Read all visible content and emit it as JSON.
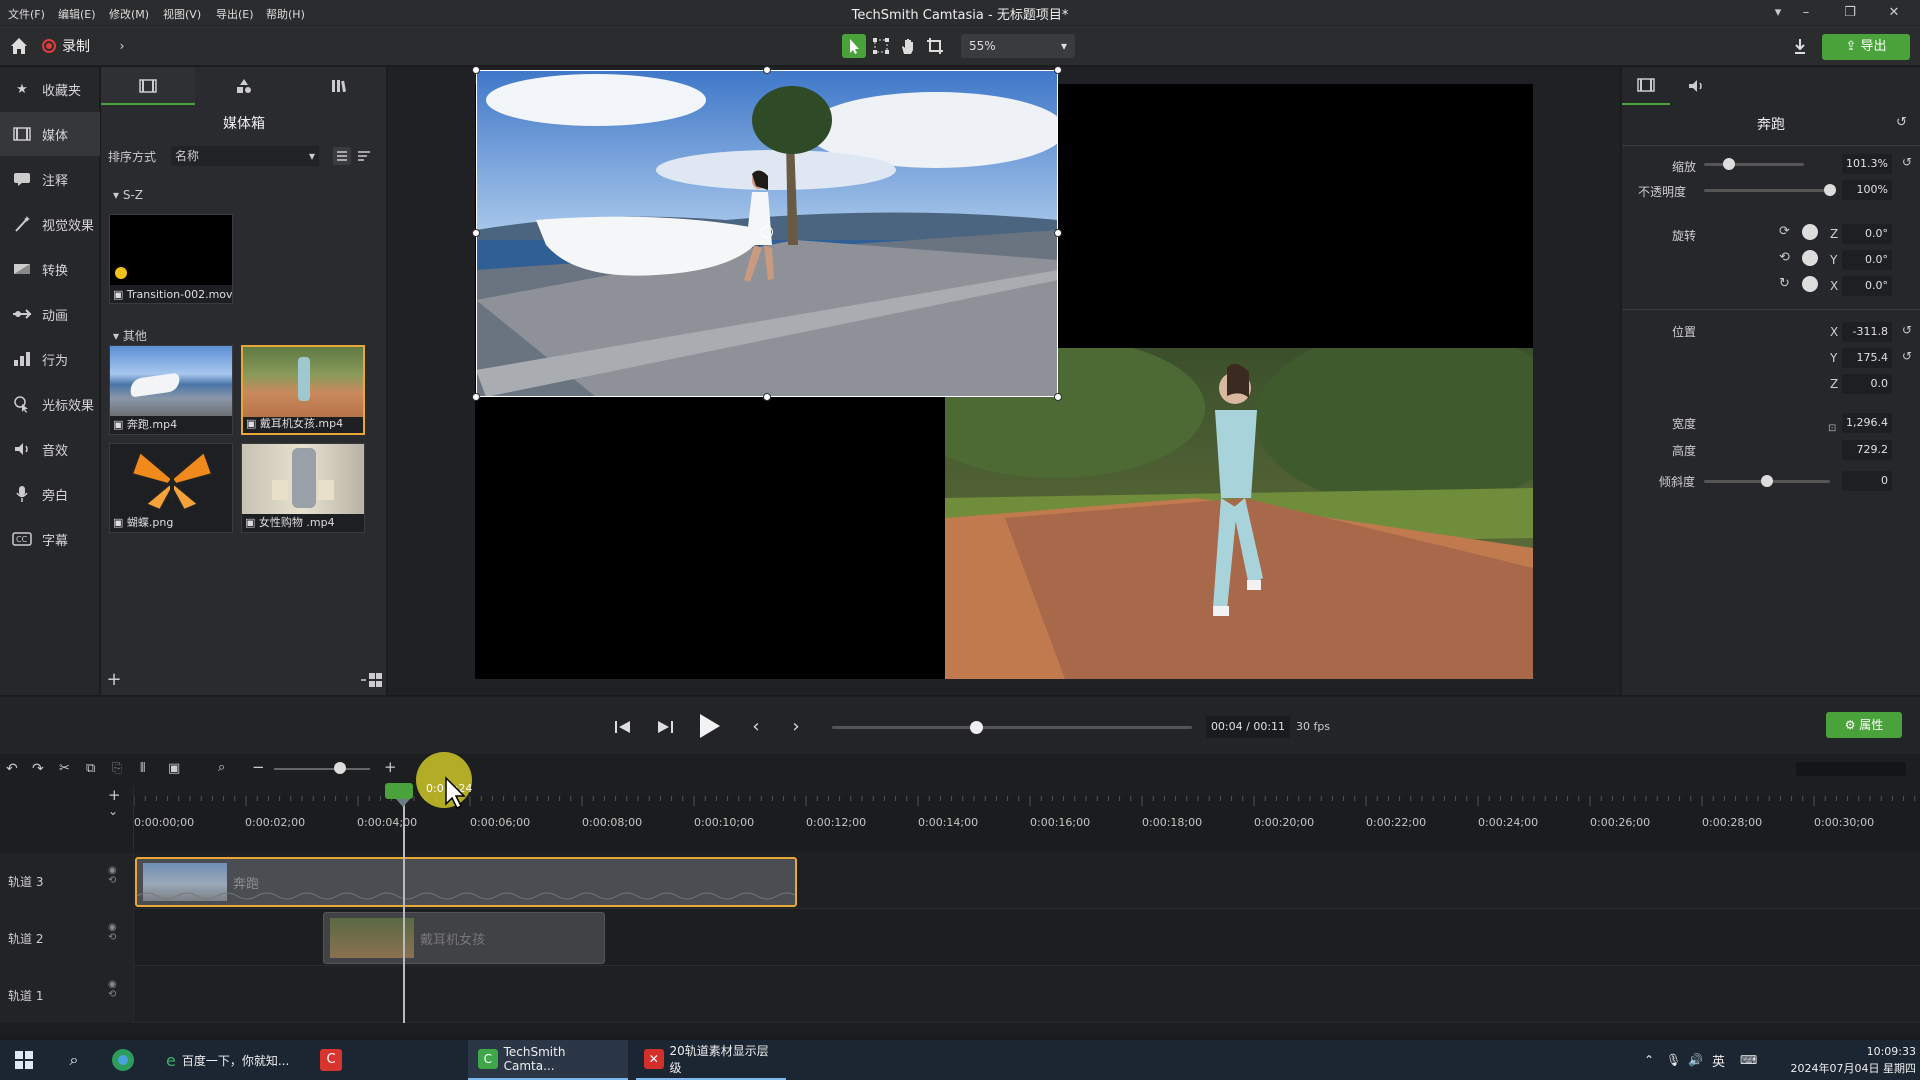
{
  "window": {
    "title": "TechSmith Camtasia - 无标题项目*",
    "menu": [
      "文件(F)",
      "编辑(E)",
      "修改(M)",
      "视图(V)",
      "导出(E)",
      "帮助(H)"
    ]
  },
  "toolbar": {
    "record_label": "录制",
    "zoom_value": "55%",
    "export_label": "导出"
  },
  "leftnav": {
    "items": [
      {
        "label": "收藏夹",
        "icon": "star-icon"
      },
      {
        "label": "媒体",
        "icon": "media-icon"
      },
      {
        "label": "注释",
        "icon": "annotation-icon"
      },
      {
        "label": "视觉效果",
        "icon": "visual-effects-icon"
      },
      {
        "label": "转换",
        "icon": "transition-icon"
      },
      {
        "label": "动画",
        "icon": "animation-icon"
      },
      {
        "label": "行为",
        "icon": "behavior-icon"
      },
      {
        "label": "光标效果",
        "icon": "cursor-effects-icon"
      },
      {
        "label": "音效",
        "icon": "audio-effects-icon"
      },
      {
        "label": "旁白",
        "icon": "voice-narration-icon"
      },
      {
        "label": "字幕",
        "icon": "captions-icon"
      }
    ]
  },
  "media": {
    "title": "媒体箱",
    "sort_label": "排序方式",
    "sort_value": "名称",
    "groups": [
      {
        "name": "S-Z",
        "items": [
          {
            "label": "Transition-002.mov"
          }
        ]
      },
      {
        "name": "其他",
        "items": [
          {
            "label": "奔跑.mp4"
          },
          {
            "label": "戴耳机女孩.mp4"
          },
          {
            "label": "蝴蝶.png"
          },
          {
            "label": "女性购物 .mp4"
          }
        ]
      }
    ]
  },
  "properties": {
    "clip_name": "奔跑",
    "scale_label": "缩放",
    "scale_value": "101.3%",
    "scale_level": 0.25,
    "opacity_label": "不透明度",
    "opacity_value": "100%",
    "opacity_level": 1.0,
    "rotation_label": "旋转",
    "rotation": {
      "z": "0.0°",
      "y": "0.0°",
      "x": "0.0°"
    },
    "position_label": "位置",
    "position": {
      "x": "-311.8",
      "y": "175.4",
      "z": "0.0"
    },
    "width_label": "宽度",
    "width_value": "1,296.4",
    "height_label": "高度",
    "height_value": "729.2",
    "skew_label": "倾斜度",
    "skew_value": "0",
    "skew_level": 0.5,
    "axis": {
      "z": "Z",
      "y": "Y",
      "x": "X"
    }
  },
  "playback": {
    "time": "00:04 / 00:11",
    "fps": "30 fps",
    "progress": 0.4,
    "props_button": "属性"
  },
  "timeline": {
    "playhead_label": "0:0…:24",
    "ticks": [
      "0:00:00;00",
      "0:00:02;00",
      "0:00:04;00",
      "0:00:06;00",
      "0:00:08;00",
      "0:00:10;00",
      "0:00:12;00",
      "0:00:14;00",
      "0:00:16;00",
      "0:00:18;00",
      "0:00:20;00",
      "0:00:22;00",
      "0:00:24;00",
      "0:00:26;00",
      "0:00:28;00",
      "0:00:30;00"
    ],
    "tracks": [
      {
        "label": "轨道 3",
        "clip": "奔跑"
      },
      {
        "label": "轨道 2",
        "clip": "戴耳机女孩"
      },
      {
        "label": "轨道 1",
        "clip": ""
      }
    ]
  },
  "taskbar": {
    "apps": [
      "百度一下，你就知...",
      "TechSmith Camta...",
      "20轨道素材显示层级"
    ],
    "ime": "英",
    "time": "10:09:33",
    "date": "2024年07月04日 星期四"
  }
}
